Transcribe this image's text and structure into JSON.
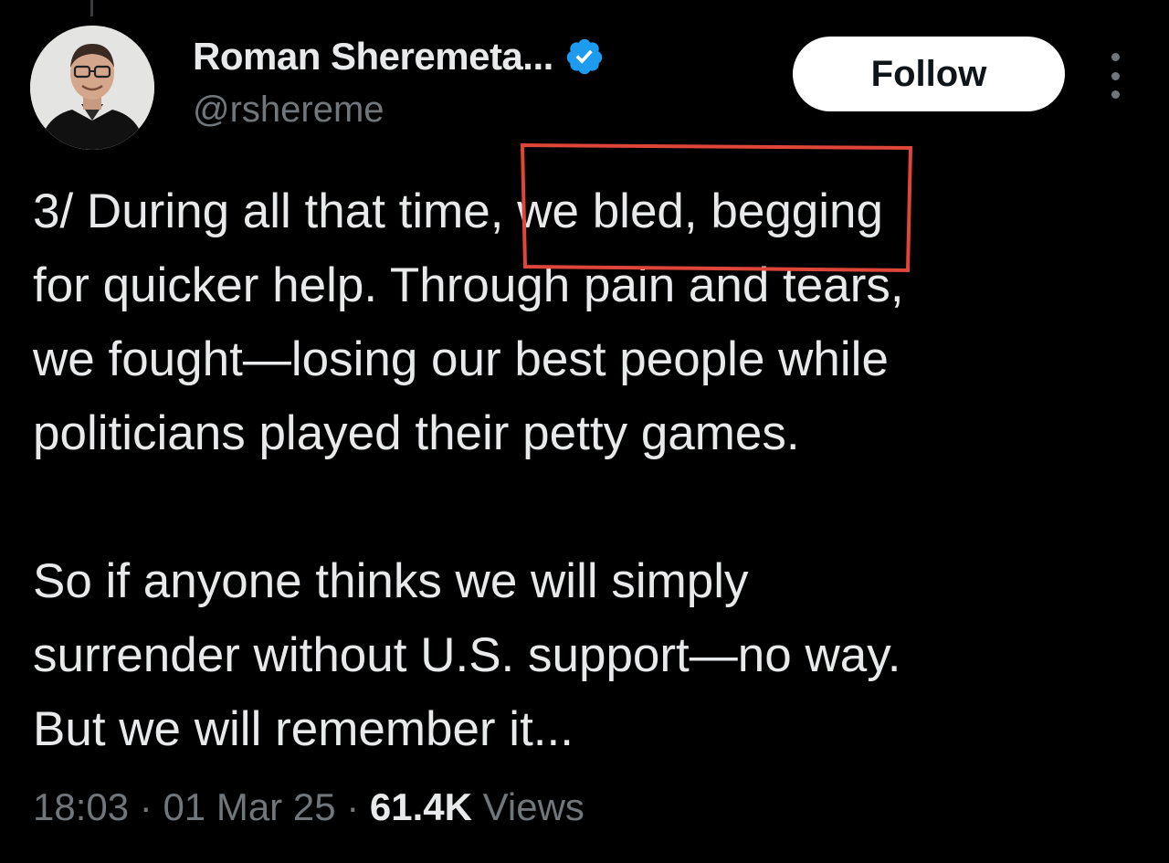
{
  "author": {
    "display_name": "Roman Sheremeta...",
    "handle": "@rshereme",
    "verified": true,
    "avatar_icon": "profile-photo"
  },
  "actions": {
    "follow_label": "Follow",
    "more_icon": "more-vertical-icon"
  },
  "tweet": {
    "paragraphs": [
      [
        "3/ During all that time, we bled, begging",
        "for quicker help. Through pain and tears,",
        "we fought—losing our best people while",
        "politicians played their petty games."
      ],
      [
        "So if anyone thinks we will simply",
        "surrender without U.S. support—no way.",
        "But we will remember it..."
      ]
    ]
  },
  "meta": {
    "time": "18:03",
    "separator": "·",
    "date": "01 Mar 25",
    "views_count": "61.4K",
    "views_label": "Views"
  },
  "colors": {
    "background": "#000000",
    "text": "#e7e9ea",
    "secondary": "#71767b",
    "verified_blue": "#1d9bf0",
    "annotation": "#e0453a"
  }
}
